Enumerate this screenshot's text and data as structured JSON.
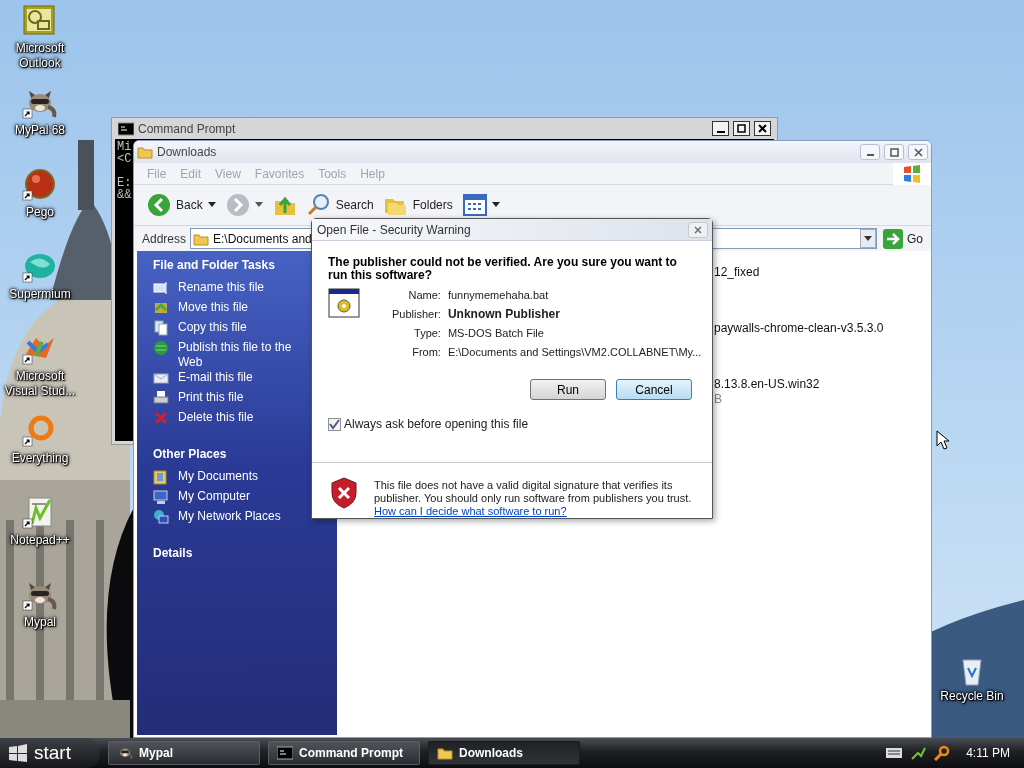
{
  "desktop_icons": [
    {
      "label": "Microsoft Outlook"
    },
    {
      "label": "MyPal 68"
    },
    {
      "label": "Pego"
    },
    {
      "label": "Supermium"
    },
    {
      "label": "Microsoft Visual Stud..."
    },
    {
      "label": "Everything"
    },
    {
      "label": "Notepad++"
    },
    {
      "label": "Mypal"
    }
  ],
  "recycle_bin": {
    "label": "Recycle Bin"
  },
  "cmd_window": {
    "title": "Command Prompt",
    "blocks": [
      {
        "lines": [
          "Mi",
          "<C"
        ]
      },
      {
        "lines": [
          "E:",
          "&&"
        ]
      }
    ]
  },
  "explorer": {
    "title": "Downloads",
    "menu": [
      "File",
      "Edit",
      "View",
      "Favorites",
      "Tools",
      "Help"
    ],
    "toolbar": {
      "back": "Back",
      "search": "Search",
      "folders": "Folders"
    },
    "address": {
      "label": "Address",
      "value": "E:\\Documents and",
      "go": "Go"
    },
    "task_sections": [
      {
        "title": "File and Folder Tasks",
        "items": [
          "Rename this file",
          "Move this file",
          "Copy this file",
          "Publish this file to the Web",
          "E-mail this file",
          "Print this file",
          "Delete this file"
        ]
      },
      {
        "title": "Other Places",
        "items": [
          "My Documents",
          "My Computer",
          "My Network Places"
        ]
      },
      {
        "title": "Details"
      }
    ],
    "files": [
      {
        "name": "12_fixed"
      },
      {
        "name": "paywalls-chrome-clean-v3.5.3.0"
      },
      {
        "name": "8.13.8.en-US.win32",
        "detail": "B"
      }
    ]
  },
  "dialog": {
    "title": "Open File - Security Warning",
    "heading": "The publisher could not be verified.  Are you sure you want to run this software?",
    "fields": [
      {
        "label": "Name:",
        "value": "funnymemehaha.bat",
        "bold": false
      },
      {
        "label": "Publisher:",
        "value": "Unknown Publisher",
        "bold": true
      },
      {
        "label": "Type:",
        "value": "MS-DOS Batch File",
        "bold": false
      },
      {
        "label": "From:",
        "value": "E:\\Documents and Settings\\VM2.COLLABNET\\My...",
        "bold": false
      }
    ],
    "buttons": [
      {
        "label": "Run",
        "default": false
      },
      {
        "label": "Cancel",
        "default": true
      }
    ],
    "checkbox": {
      "label": "Always ask before opening this file",
      "checked": true
    },
    "warning": "This file does not have a valid digital signature that verifies its publisher.  You should only run software from publishers you trust.",
    "link": "How can I decide what software to run?"
  },
  "taskbar": {
    "start": "start",
    "buttons": [
      {
        "label": "Mypal",
        "selected": false
      },
      {
        "label": "Command Prompt",
        "selected": false
      },
      {
        "label": "Downloads",
        "selected": true
      }
    ],
    "clock": "4:11 PM"
  }
}
